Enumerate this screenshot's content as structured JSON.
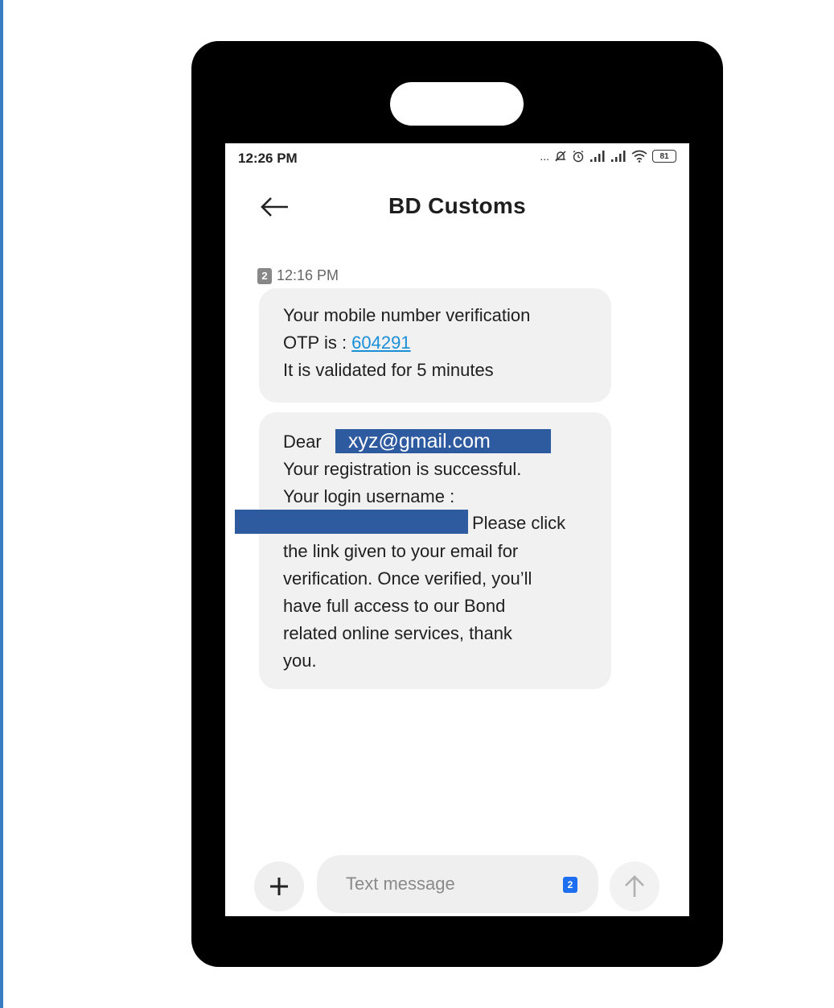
{
  "status_bar": {
    "time": "12:26 PM",
    "dots": "...",
    "battery": "81"
  },
  "header": {
    "title": "BD Customs"
  },
  "messages": {
    "sim_slot": "2",
    "timestamp": "12:16 PM",
    "otp_message": {
      "line1": "Your mobile number verification",
      "otp_prefix": "OTP is : ",
      "otp_code": "604291",
      "line3": "It is validated for 5 minutes"
    },
    "registration_message": {
      "dear": "Dear ",
      "email": "xyz@gmail.com",
      "line2": "Your registration is successful.",
      "line3": "Your login username :",
      "please_click": "Please click",
      "line5": "the link given to your email for",
      "line6": "verification.  Once verified, you’ll",
      "line7": "have full access to our Bond",
      "line8": "related online services, thank",
      "line9": "you."
    }
  },
  "composer": {
    "placeholder": "Text message",
    "sim_slot": "2"
  },
  "colors": {
    "link": "#1a8fd8",
    "redaction": "#2e5aa0",
    "sim_button": "#1e6ff0"
  }
}
